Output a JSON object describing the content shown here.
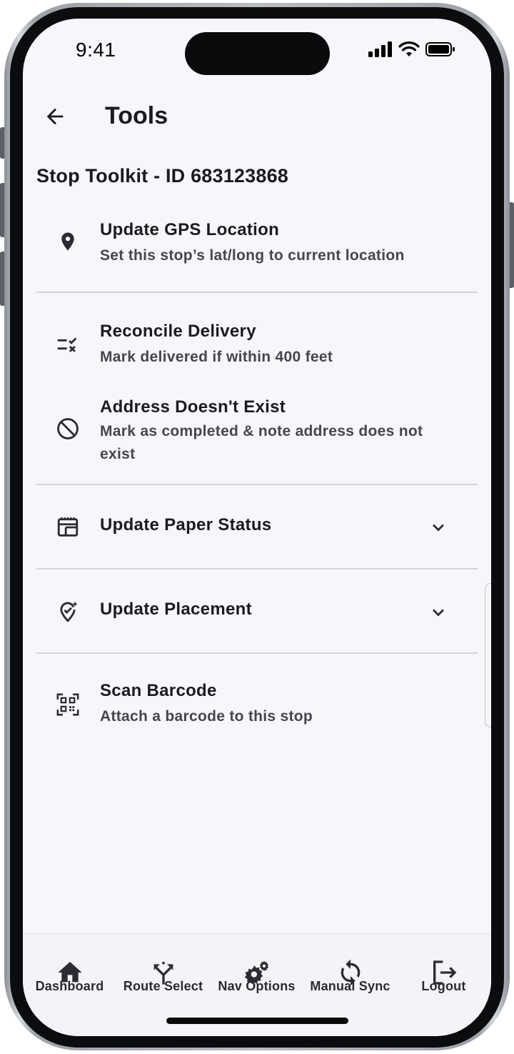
{
  "status_bar": {
    "time": "9:41"
  },
  "header": {
    "title": "Tools"
  },
  "toolkit": {
    "heading": "Stop Toolkit - ID 683123868"
  },
  "actions": [
    {
      "icon": "map-pin-icon",
      "title": "Update GPS Location",
      "description": "Set this stop’s lat/long to current location"
    },
    {
      "icon": "checklist-cross-icon",
      "title": "Reconcile Delivery",
      "description": "Mark delivered if within 400 feet"
    },
    {
      "icon": "block-icon",
      "title": "Address Doesn't Exist",
      "description": "Mark as completed & note address does not exist"
    },
    {
      "icon": "calendar-view-icon",
      "title": "Update Paper Status"
    },
    {
      "icon": "location-check-icon",
      "title": "Update Placement"
    },
    {
      "icon": "qr-scan-icon",
      "title": "Scan Barcode",
      "description": "Attach a barcode to this stop"
    }
  ],
  "bottom_nav": [
    {
      "icon": "home-icon",
      "label": "Dashboard"
    },
    {
      "icon": "fork-icon",
      "label": "Route Select"
    },
    {
      "icon": "gears-icon",
      "label": "Nav Options"
    },
    {
      "icon": "sync-icon",
      "label": "Manual Sync"
    },
    {
      "icon": "logout-icon",
      "label": "Logout"
    }
  ]
}
